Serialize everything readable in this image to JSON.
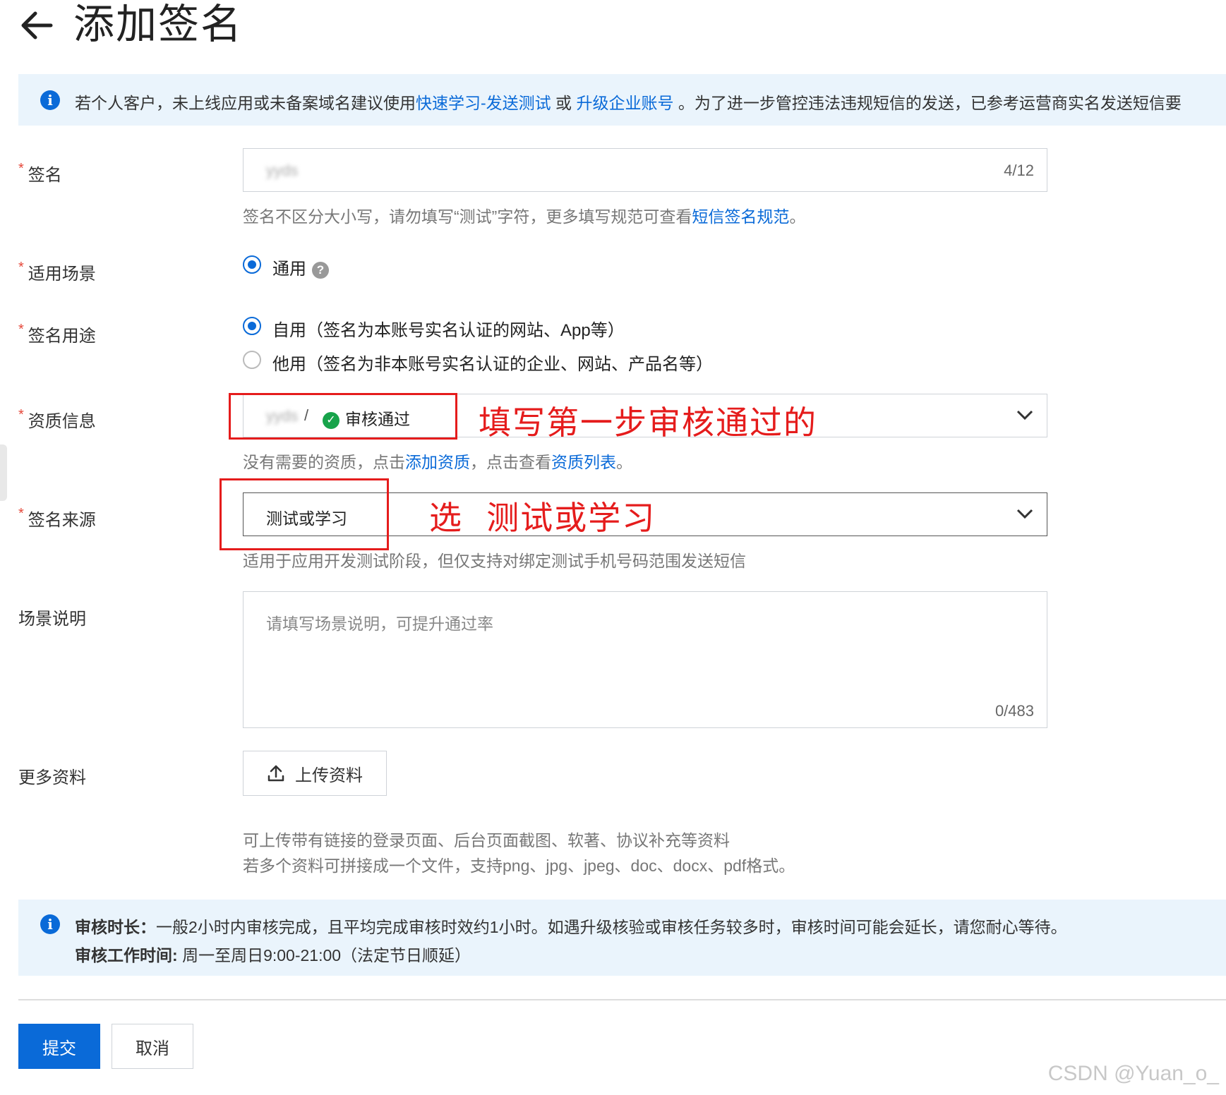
{
  "page": {
    "title": "添加签名"
  },
  "top_notice": {
    "prefix": "若个人客户，未上线应用或未备案域名建议使用",
    "link1": "快速学习-发送测试",
    "middle": " 或 ",
    "link2": "升级企业账号",
    "suffix": " 。为了进一步管控违法违规短信的发送，已参考运营商实名发送短信要"
  },
  "fields": {
    "signature": {
      "label": "签名",
      "value": "yyds",
      "counter": "4/12",
      "help_prefix": "签名不区分大小写，请勿填写“测试”字符，更多填写规范可查看",
      "help_link": "短信签名规范",
      "help_suffix": "。"
    },
    "scene": {
      "label": "适用场景",
      "option": "通用"
    },
    "purpose": {
      "label": "签名用途",
      "options": [
        {
          "label": "自用（签名为本账号实名认证的网站、App等）",
          "selected": true
        },
        {
          "label": "他用（签名为非本账号实名认证的企业、网站、产品名等）",
          "selected": false
        }
      ]
    },
    "qualification": {
      "label": "资质信息",
      "value_name": "yyds",
      "separator": "/",
      "status": "审核通过",
      "help_prefix": "没有需要的资质，点击",
      "help_link1": "添加资质",
      "help_middle": "，点击查看",
      "help_link2": "资质列表",
      "help_suffix": "。"
    },
    "source": {
      "label": "签名来源",
      "value": "测试或学习",
      "help": "适用于应用开发测试阶段，但仅支持对绑定测试手机号码范围发送短信"
    },
    "scene_desc": {
      "label": "场景说明",
      "placeholder": "请填写场景说明，可提升通过率",
      "counter": "0/483"
    },
    "more_docs": {
      "label": "更多资料",
      "upload_label": "上传资料",
      "help_line1": "可上传带有链接的登录页面、后台页面截图、软著、协议补充等资料",
      "help_line2": "若多个资料可拼接成一个文件，支持png、jpg、jpeg、doc、docx、pdf格式。"
    }
  },
  "annotations": {
    "qualification_note": "填写第一步审核通过的",
    "source_note": "选  测试或学习"
  },
  "bottom_notice": {
    "line1_bold": "审核时长：",
    "line1_text": "一般2小时内审核完成，且平均完成审核时效约1小时。如遇升级核验或审核任务较多时，审核时间可能会延长，请您耐心等待。",
    "line2_bold": "审核工作时间: ",
    "line2_text": "周一至周日9:00-21:00（法定节日顺延）"
  },
  "actions": {
    "submit": "提交",
    "cancel": "取消"
  },
  "watermark": "CSDN @Yuan_o_",
  "colors": {
    "primary": "#0a6ad8",
    "annotation_red": "#e51c1c",
    "notice_bg": "#eaf4fc",
    "required_star": "#e5483a",
    "success_green": "#17a34a"
  },
  "icons": [
    "back-arrow-icon",
    "info-icon",
    "question-icon",
    "check-circle-icon",
    "chevron-down-icon",
    "upload-icon"
  ]
}
